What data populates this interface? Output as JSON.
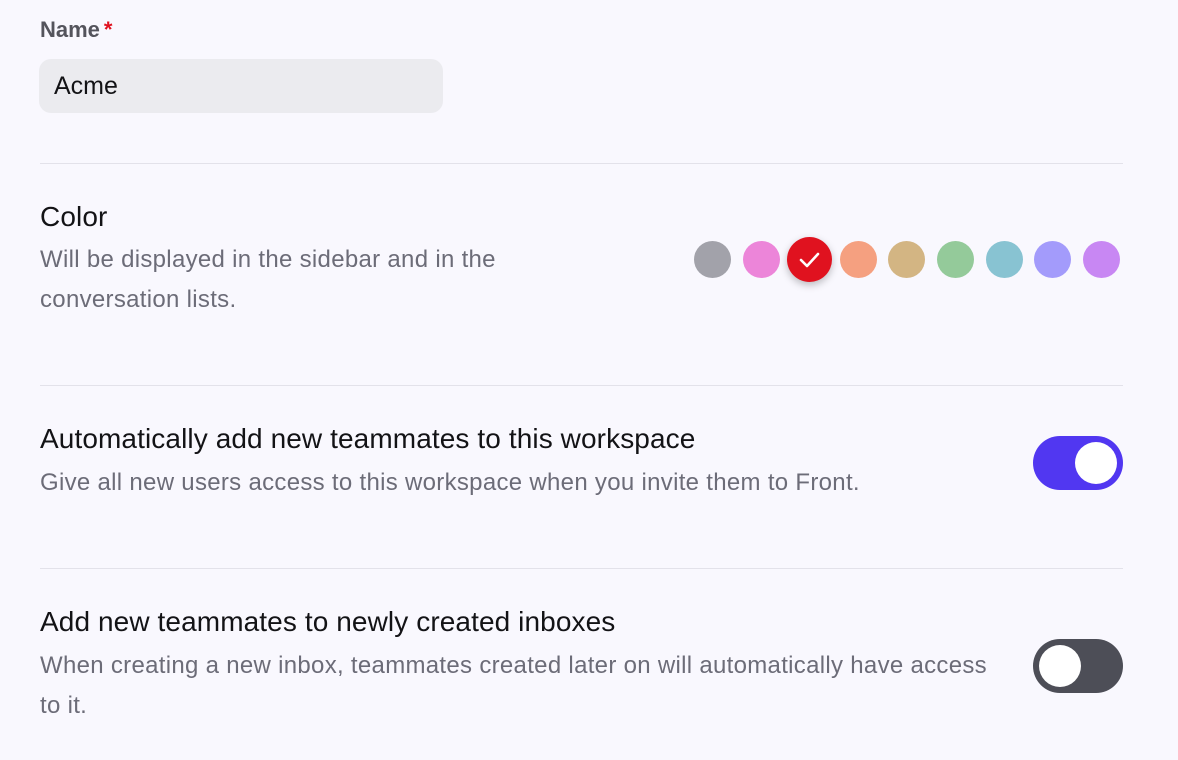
{
  "name_field": {
    "label": "Name",
    "required_marker": "*",
    "value": "Acme"
  },
  "color_section": {
    "title": "Color",
    "description": "Will be displayed in the sidebar and in the conversation lists.",
    "swatches": [
      {
        "color": "#a2a2aa",
        "selected": false
      },
      {
        "color": "#ec85d9",
        "selected": false
      },
      {
        "color": "#e0121f",
        "selected": true
      },
      {
        "color": "#f5a080",
        "selected": false
      },
      {
        "color": "#d3b583",
        "selected": false
      },
      {
        "color": "#94ca9a",
        "selected": false
      },
      {
        "color": "#88c3d2",
        "selected": false
      },
      {
        "color": "#a39bfb",
        "selected": false
      },
      {
        "color": "#c887f3",
        "selected": false
      }
    ],
    "check_icon": "check-icon"
  },
  "auto_add_section": {
    "title": "Automatically add new teammates to this workspace",
    "description": "Give all new users access to this workspace when you invite them to Front.",
    "toggle_on": true,
    "toggle_color": "#5137f1"
  },
  "inbox_section": {
    "title": "Add new teammates to newly created inboxes",
    "description": "When creating a new inbox, teammates created later on will automatically have access to it.",
    "toggle_on": false,
    "toggle_color": "#4d4e57"
  }
}
